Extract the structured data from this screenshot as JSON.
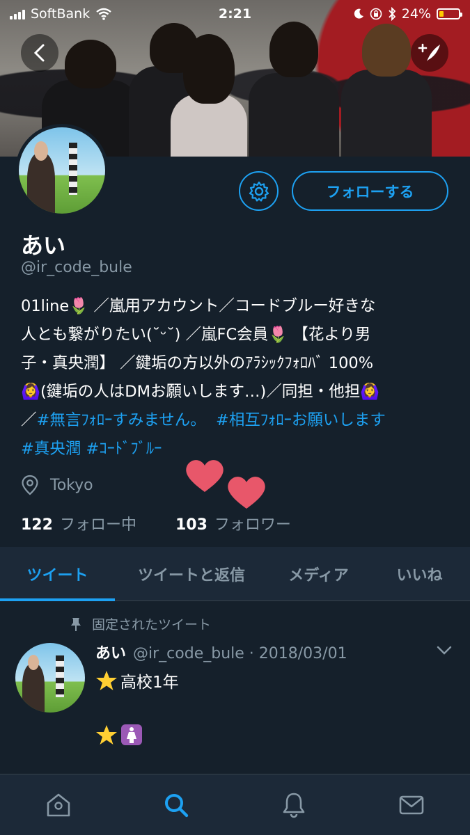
{
  "status_bar": {
    "carrier": "SoftBank",
    "time": "2:21",
    "battery_percent": "24%",
    "battery_level": 0.24,
    "battery_color": "#ffcc00"
  },
  "header": {
    "back_icon": "back-chevron-icon",
    "compose_icon": "compose-feather-icon"
  },
  "profile": {
    "name": "あい",
    "handle": "@ir_code_bule",
    "follow_button": "フォローする",
    "bio": {
      "line1": "01line🌷 ／嵐用アカウント／コードブルー好きな",
      "line2": "人とも繋がりたい(˘ᵕ˘) ／嵐FC会員🌷 【花より男",
      "line3": "子・真央潤】 ／鍵垢の方以外のｱﾗｼｯｸﾌｫﾛﾊﾞ 100%",
      "line4": "🙆‍♀️(鍵垢の人はDMお願いします…)／同担・他担🙆‍♀️",
      "line5_prefix": "／",
      "tag1": "#無言ﾌｫﾛｰすみません。",
      "tag2": "#相互ﾌｫﾛｰお願いします",
      "tag3": "#真央潤",
      "tag4": "#ｺｰﾄﾞﾌﾞﾙｰ"
    },
    "location": "Tokyo",
    "following_count": "122",
    "following_label": "フォロー中",
    "followers_count": "103",
    "followers_label": "フォロワー"
  },
  "tabs": [
    {
      "label": "ツイート"
    },
    {
      "label": "ツイートと返信"
    },
    {
      "label": "メディア"
    },
    {
      "label": "いいね"
    }
  ],
  "tweet": {
    "pinned_label": "固定されたツイート",
    "author_name": "あい",
    "author_meta": "@ir_code_bule · 2018/03/01",
    "line1_text": "高校1年"
  },
  "colors": {
    "accent": "#1da1f2",
    "background": "#15202b",
    "secondary_text": "#8899a6"
  }
}
